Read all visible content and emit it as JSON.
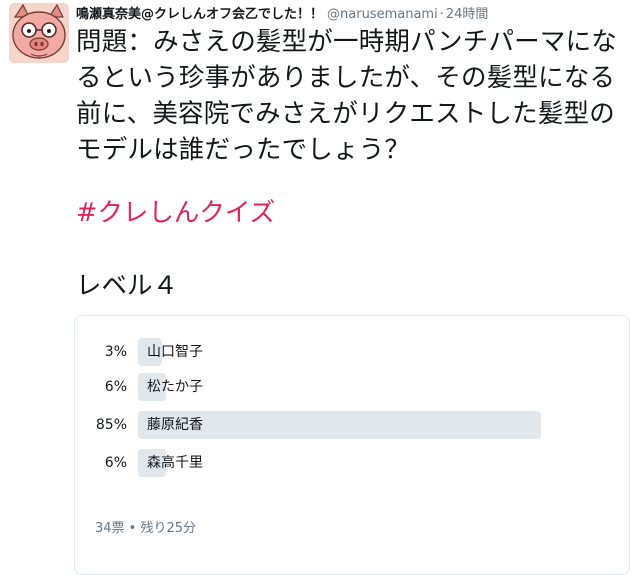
{
  "author": {
    "display_name": "鳴瀬真奈美@クレしんオフ会乙でした！！",
    "handle": "@narusemanami",
    "separator": "·",
    "timestamp": "24時間"
  },
  "tweet": {
    "text": "問題：みさえの髪型が一時期パンチパーマになるという珍事がありましたが、その髪型になる前に、美容院でみさえがリクエストした髪型のモデルは誰だったでしょう？",
    "hashtag": "#クレしんクイズ",
    "level": "レベル４"
  },
  "poll": {
    "options": [
      {
        "percent_label": "3%",
        "percent": 3,
        "label": "山口智子"
      },
      {
        "percent_label": "6%",
        "percent": 6,
        "label": "松たか子"
      },
      {
        "percent_label": "85%",
        "percent": 85,
        "label": "藤原紀香"
      },
      {
        "percent_label": "6%",
        "percent": 6,
        "label": "森高千里"
      }
    ],
    "footer": "34票 • 残り25分"
  },
  "colors": {
    "text": "#14171a",
    "secondary": "#657786",
    "hashtag": "#e0245e",
    "poll_bar": "#e1e8ed",
    "avatar_bg": "#e7a8a2"
  },
  "icons": {
    "avatar": "cartoon-pig-avatar"
  }
}
